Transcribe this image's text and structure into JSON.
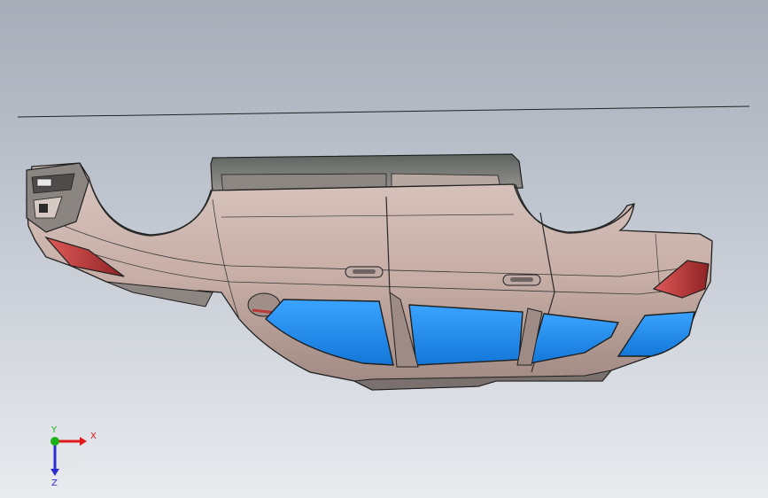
{
  "viewport": {
    "background_top": "#a7adb8",
    "background_bottom": "#e9ebef"
  },
  "model": {
    "body_color": "#c9b2ab",
    "glass_color": "#1d8ff0",
    "lamp_color": "#b8393a",
    "edge_color": "#2a2a2a"
  },
  "triad": {
    "x_label": "X",
    "y_label": "Y",
    "z_label": "Z",
    "x_color": "#e01818",
    "y_color": "#19b319",
    "z_color": "#2c2ccf"
  }
}
